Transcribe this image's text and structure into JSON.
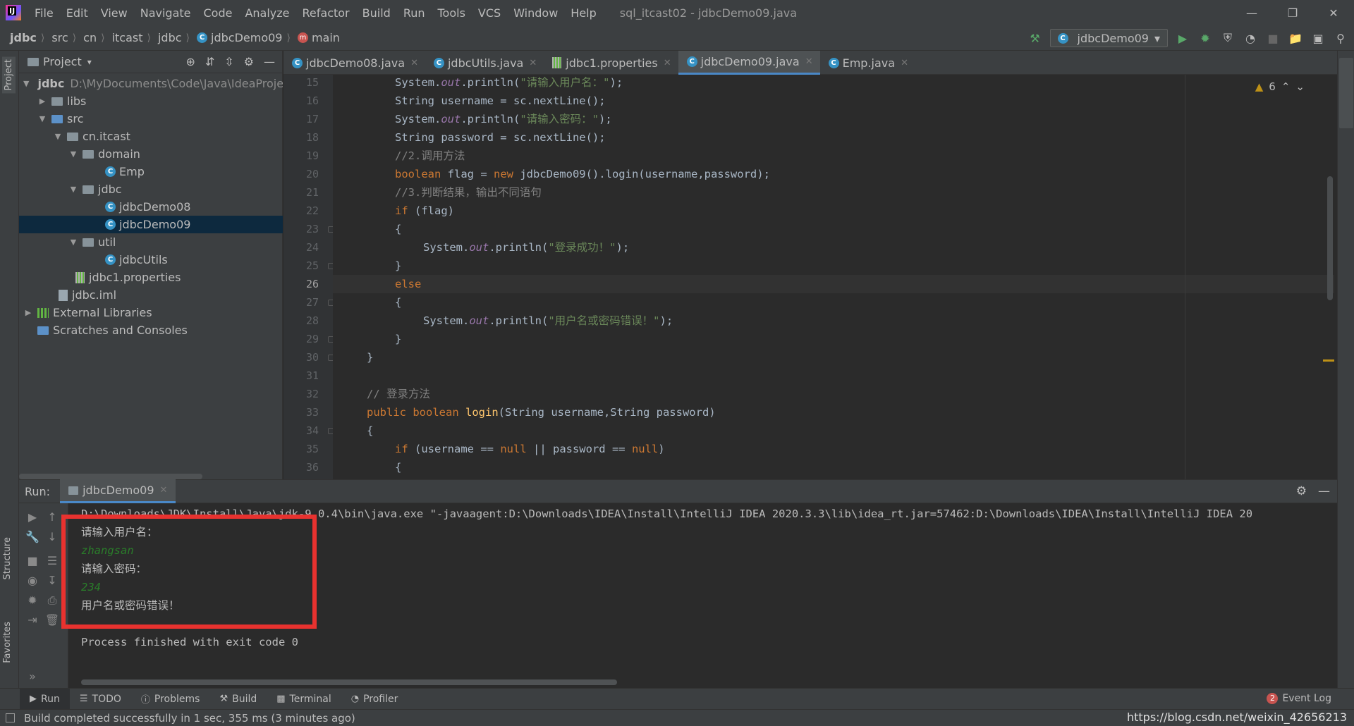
{
  "menu": [
    "File",
    "Edit",
    "View",
    "Navigate",
    "Code",
    "Analyze",
    "Refactor",
    "Build",
    "Run",
    "Tools",
    "VCS",
    "Window",
    "Help"
  ],
  "window_title": "sql_itcast02 - jdbcDemo09.java",
  "breadcrumb": [
    "jdbc",
    "src",
    "cn",
    "itcast",
    "jdbc",
    "jdbcDemo09",
    "main"
  ],
  "run_config": "jdbcDemo09",
  "project": {
    "title": "Project",
    "root_name": "jdbc",
    "root_path": "D:\\MyDocuments\\Code\\Java\\IdeaProje",
    "items": [
      "libs",
      "src",
      "cn.itcast",
      "domain",
      "Emp",
      "jdbc",
      "jdbcDemo08",
      "jdbcDemo09",
      "util",
      "jdbcUtils",
      "jdbc1.properties",
      "jdbc.iml",
      "External Libraries",
      "Scratches and Consoles"
    ]
  },
  "tabs": [
    "jdbcDemo08.java",
    "jdbcUtils.java",
    "jdbc1.properties",
    "jdbcDemo09.java",
    "Emp.java"
  ],
  "warnings_count": "6",
  "line_numbers": [
    "15",
    "16",
    "17",
    "18",
    "19",
    "20",
    "21",
    "22",
    "23",
    "24",
    "25",
    "26",
    "27",
    "28",
    "29",
    "30",
    "31",
    "32",
    "33",
    "34",
    "35",
    "36"
  ],
  "code": {
    "l15_a": "System.",
    "l15_b": "out",
    "l15_c": ".println(",
    "l15_str": "\"请输入用户名：\"",
    "l15_end": ");",
    "l16": "String username = sc.nextLine();",
    "l17_a": "System.",
    "l17_b": "out",
    "l17_c": ".println(",
    "l17_str": "\"请输入密码：\"",
    "l17_end": ");",
    "l18": "String password = sc.nextLine();",
    "l19": "//2.调用方法",
    "l20_kw": "boolean",
    "l20_a": " flag = ",
    "l20_new": "new",
    "l20_b": " jdbcDemo09().login(username,password);",
    "l21": "//3.判断结果，输出不同语句",
    "l22_kw": "if",
    "l22_b": " (flag)",
    "l23": "{",
    "l24_a": "System.",
    "l24_b": "out",
    "l24_c": ".println(",
    "l24_str": "\"登录成功！\"",
    "l24_end": ");",
    "l25": "}",
    "l26": "else",
    "l27": "{",
    "l28_a": "System.",
    "l28_b": "out",
    "l28_c": ".println(",
    "l28_str": "\"用户名或密码错误！\"",
    "l28_end": ");",
    "l29": "}",
    "l30": "}",
    "l32": "// 登录方法",
    "l33_kw": "public boolean",
    "l33_fn": "login",
    "l33_b": "(String username,String password)",
    "l34": "{",
    "l35_kw": "if",
    "l35_a": " (username == ",
    "l35_null1": "null",
    "l35_b": " || password == ",
    "l35_null2": "null",
    "l35_c": ")",
    "l36": "{"
  },
  "run": {
    "label": "Run:",
    "tab": "jdbcDemo09",
    "command": "D:\\Downloads\\JDK\\Install\\Java\\jdk-9.0.4\\bin\\java.exe \"-javaagent:D:\\Downloads\\IDEA\\Install\\IntelliJ IDEA 2020.3.3\\lib\\idea_rt.jar=57462:D:\\Downloads\\IDEA\\Install\\IntelliJ IDEA 20",
    "prompt_user": "请输入用户名：",
    "input_user": "zhangsan",
    "prompt_pass": "请输入密码：",
    "input_pass": "234",
    "result": "用户名或密码错误！",
    "exit": "Process finished with exit code 0"
  },
  "bottom_tools": [
    "Run",
    "TODO",
    "Problems",
    "Build",
    "Terminal",
    "Profiler"
  ],
  "event_log": {
    "count": "2",
    "label": "Event Log"
  },
  "side_tabs": {
    "project": "Project",
    "structure": "Structure",
    "favorites": "Favorites"
  },
  "status": "Build completed successfully in 1 sec, 355 ms (3 minutes ago)",
  "watermark": "https://blog.csdn.net/weixin_42656213",
  "colors": {
    "keyword": "#cc7832",
    "string": "#6a8759",
    "comment": "#808080",
    "highlight_box": "#e8322f",
    "console_input": "#2a7d2a"
  }
}
